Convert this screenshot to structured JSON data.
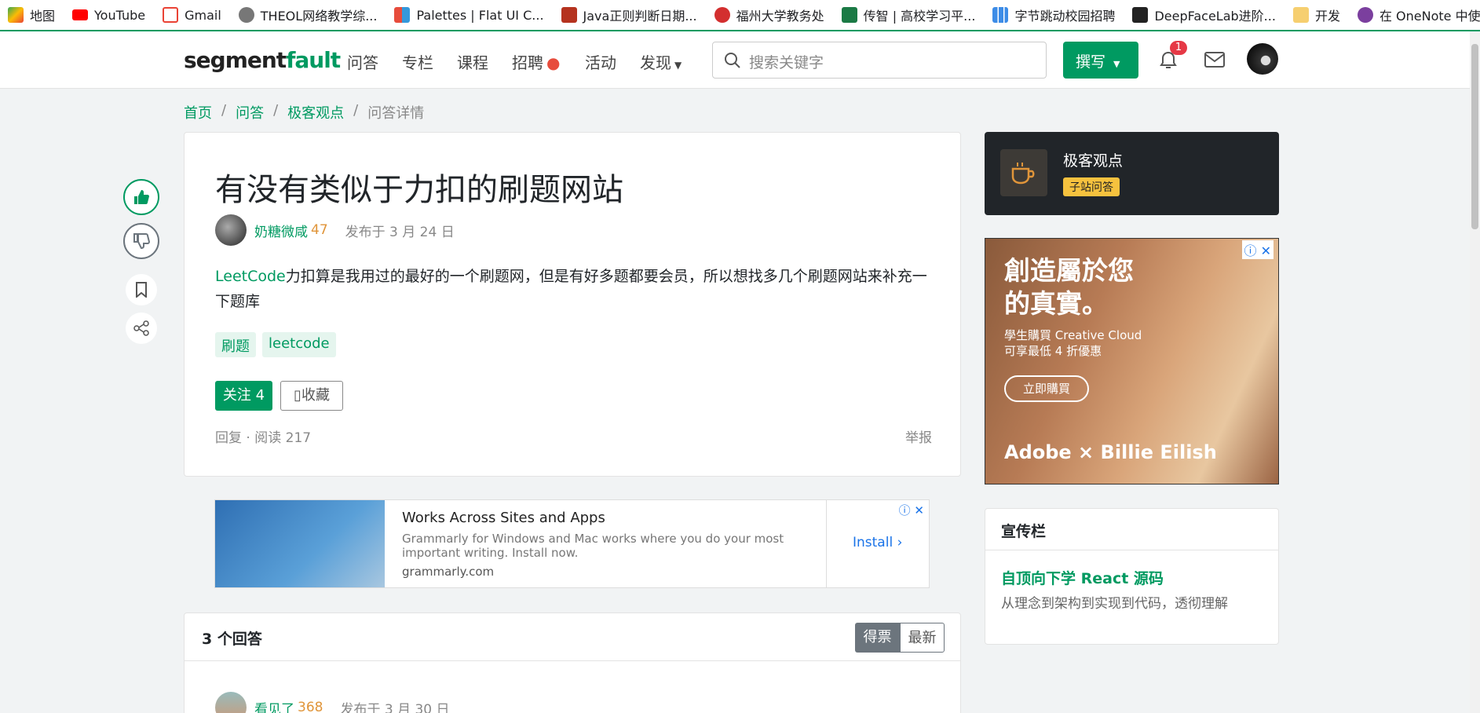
{
  "bookmarks": [
    "地图",
    "YouTube",
    "Gmail",
    "THEOL网络教学综...",
    "Palettes | Flat UI C...",
    "Java正则判断日期...",
    "福州大学教务处",
    "传智 | 高校学习平...",
    "字节跳动校园招聘",
    "DeepFaceLab进阶...",
    "开发",
    "在 OneNote 中使..."
  ],
  "nav": {
    "logo_a": "segment",
    "logo_b": "fault",
    "items": [
      "问答",
      "专栏",
      "课程",
      "招聘",
      "活动",
      "发现"
    ],
    "search_placeholder": "搜索关键字",
    "write": "撰写",
    "badge": "1"
  },
  "breadcrumb": [
    "首页",
    "问答",
    "极客观点",
    "问答详情"
  ],
  "question": {
    "title": "有没有类似于力扣的刷题网站",
    "author": "奶糖微咸",
    "reputation": "47",
    "posted": "发布于 3 月 24 日",
    "body_link": "LeetCode",
    "body": "力扣算是我用过的最好的一个刷题网，但是有好多题都要会员，所以想找多几个刷题网站来补充一下题库",
    "tags": [
      "刷题",
      "leetcode"
    ],
    "follow": "关注 4",
    "collect": "收藏",
    "reply": "回复",
    "reads": "阅读 217",
    "report": "举报"
  },
  "ad_grammarly": {
    "title": "Works Across Sites and Apps",
    "desc": "Grammarly for Windows and Mac works where you do your most important writing. Install now.",
    "url": "grammarly.com",
    "install": "Install"
  },
  "answers": {
    "count": "3 个回答",
    "sort_votes": "得票",
    "sort_new": "最新",
    "first_author": "看见了",
    "first_rep": "368",
    "first_posted": "发布于 3 月 30 日"
  },
  "community": {
    "name": "极客观点",
    "badge": "子站问答"
  },
  "ad_adobe": {
    "headline1": "創造屬於您",
    "headline2": "的真實。",
    "sub1": "學生購買 Creative Cloud",
    "sub2": "可享最低 4 折優惠",
    "button": "立即購買",
    "brand": "Adobe × Billie Eilish"
  },
  "promo": {
    "header": "宣传栏",
    "title": "自顶向下学 React 源码",
    "desc": "从理念到架构到实现到代码，透彻理解"
  }
}
